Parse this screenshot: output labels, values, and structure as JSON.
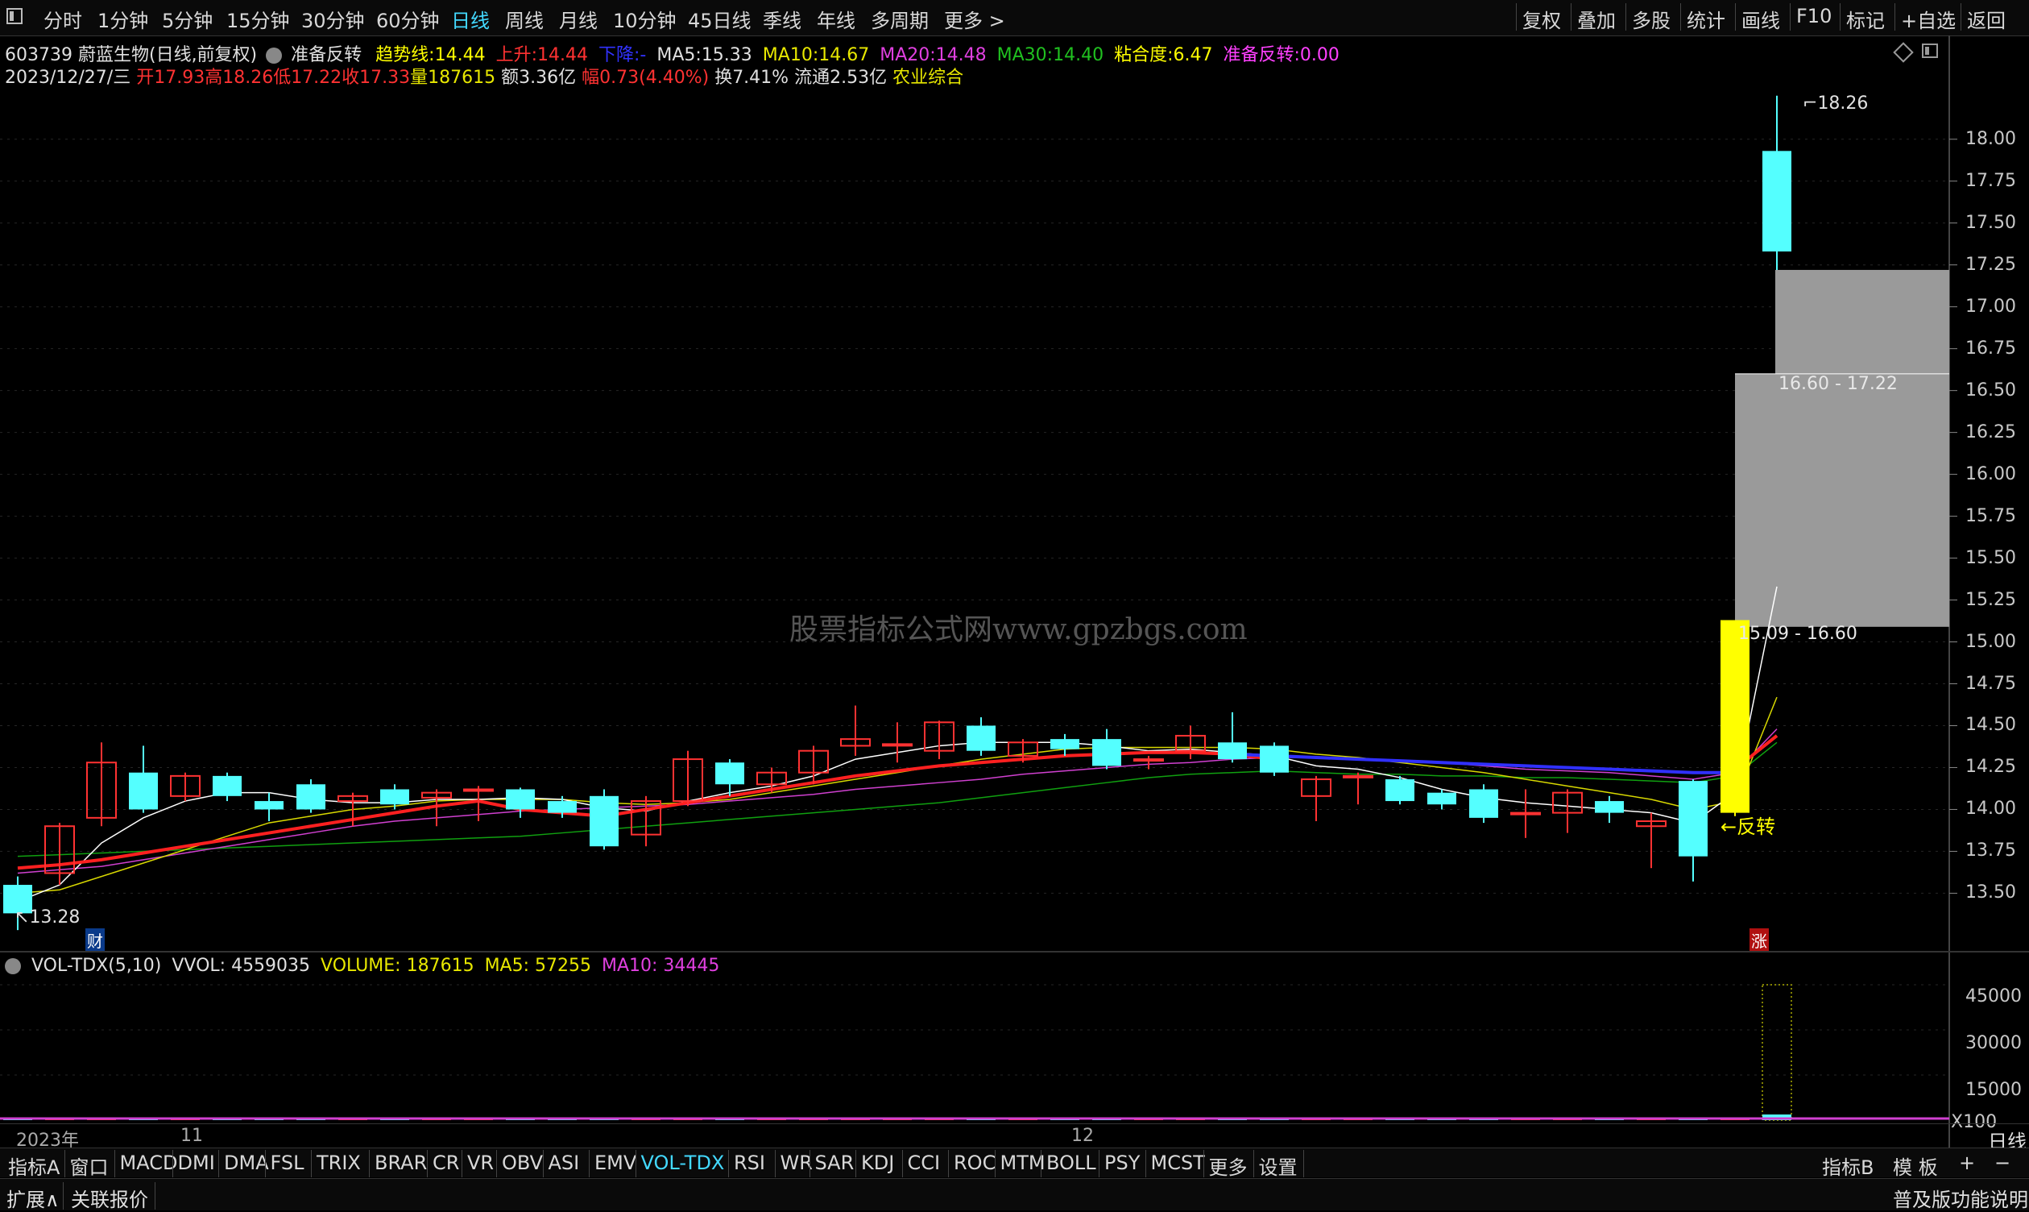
{
  "toolbar": {
    "periods": [
      "分时",
      "1分钟",
      "5分钟",
      "15分钟",
      "30分钟",
      "60分钟",
      "日线",
      "周线",
      "月线",
      "10分钟",
      "45日线",
      "季线",
      "年线",
      "多周期",
      "更多 >"
    ],
    "active_period": "日线",
    "right_buttons": [
      "复权",
      "叠加",
      "多股",
      "统计",
      "画线",
      "F10",
      "标记",
      "+自选",
      "返回"
    ]
  },
  "header": {
    "code": "603739",
    "name_mode": "蔚蓝生物(日线,前复权)",
    "indicator_name": "准备反转",
    "trend_label": "趋势线:",
    "trend_value": "14.44",
    "up_label": "上升:",
    "up_value": "14.44",
    "down_label": "下降:",
    "down_value": "-",
    "ma5_label": "MA5:",
    "ma5_value": "15.33",
    "ma10_label": "MA10:",
    "ma10_value": "14.67",
    "ma20_label": "MA20:",
    "ma20_value": "14.48",
    "ma30_label": "MA30:",
    "ma30_value": "14.40",
    "stick_label": "粘合度:",
    "stick_value": "6.47",
    "ready_label": "准备反转:",
    "ready_value": "0.00"
  },
  "quote": {
    "date": "2023/12/27/三",
    "open": "开17.93",
    "high": "高18.26",
    "low": "低17.22",
    "close": "收17.33",
    "volume": "量187615",
    "amount": "额3.36亿",
    "change": "幅0.73(4.40%)",
    "turnover": "换7.41%",
    "float": "流通2.53亿",
    "sector": "农业综合"
  },
  "price_axis": [
    "18.00",
    "17.75",
    "17.50",
    "17.25",
    "17.00",
    "16.75",
    "16.50",
    "16.25",
    "16.00",
    "15.75",
    "15.50",
    "15.25",
    "15.00",
    "14.75",
    "14.50",
    "14.25",
    "14.00",
    "13.75",
    "13.50"
  ],
  "annotations": {
    "high_mark": "18.26",
    "low_mark": "13.28",
    "zone_upper": "16.60 - 17.22",
    "zone_lower": "15.09 - 16.60",
    "reversal": "←反转",
    "fin_badge": "财",
    "zhang_badge": "涨",
    "watermark": "股票指标公式网www.gpzbgs.com"
  },
  "volume_header": {
    "name": "VOL-TDX(5,10)",
    "vvol": "VVOL: 4559035",
    "volume": "VOLUME: 187615",
    "ma5": "MA5: 57255",
    "ma10": "MA10: 34445"
  },
  "volume_axis": [
    "45000",
    "30000",
    "15000",
    "X100"
  ],
  "date_axis": [
    "2023年",
    "11",
    "12"
  ],
  "period_label": "日线",
  "indicator_tabs": [
    "指标A",
    "窗口",
    "MACD",
    "DMI",
    "DMA",
    "FSL",
    "TRIX",
    "BRAR",
    "CR",
    "VR",
    "OBV",
    "ASI",
    "EMV",
    "VOL-TDX",
    "RSI",
    "WR",
    "SAR",
    "KDJ",
    "CCI",
    "ROC",
    "MTM",
    "BOLL",
    "PSY",
    "MCST",
    "更多",
    "设置"
  ],
  "active_indicator": "VOL-TDX",
  "right_tabs": [
    "指标B",
    "模 板",
    "+",
    "−"
  ],
  "bottom": {
    "expand": "扩展∧",
    "related": "关联报价",
    "help": "普及版功能说明"
  },
  "colors": {
    "up": "#ff3232",
    "down": "#54ffff",
    "trend": "#ffff00",
    "ma5": "#ffffff",
    "ma10": "#ffff00",
    "ma20": "#ff00ff",
    "ma30": "#00a000"
  },
  "chart_data": {
    "type": "candlestick",
    "ylim": [
      13.3,
      18.35
    ],
    "candles": [
      {
        "o": 13.55,
        "c": 13.38,
        "h": 13.6,
        "l": 13.28
      },
      {
        "o": 13.62,
        "c": 13.9,
        "h": 13.92,
        "l": 13.55
      },
      {
        "o": 13.95,
        "c": 14.28,
        "h": 14.4,
        "l": 13.9
      },
      {
        "o": 14.22,
        "c": 14.0,
        "h": 14.38,
        "l": 13.98
      },
      {
        "o": 14.08,
        "c": 14.2,
        "h": 14.22,
        "l": 14.05
      },
      {
        "o": 14.2,
        "c": 14.08,
        "h": 14.22,
        "l": 14.05
      },
      {
        "o": 14.05,
        "c": 14.0,
        "h": 14.1,
        "l": 13.93
      },
      {
        "o": 14.15,
        "c": 14.0,
        "h": 14.18,
        "l": 13.98
      },
      {
        "o": 14.05,
        "c": 14.08,
        "h": 14.1,
        "l": 13.9
      },
      {
        "o": 14.12,
        "c": 14.03,
        "h": 14.15,
        "l": 14.0
      },
      {
        "o": 14.07,
        "c": 14.1,
        "h": 14.12,
        "l": 13.9
      },
      {
        "o": 14.12,
        "c": 14.12,
        "h": 14.14,
        "l": 13.93
      },
      {
        "o": 14.12,
        "c": 14.0,
        "h": 14.13,
        "l": 13.95
      },
      {
        "o": 14.05,
        "c": 13.98,
        "h": 14.08,
        "l": 13.95
      },
      {
        "o": 14.08,
        "c": 13.78,
        "h": 14.12,
        "l": 13.76
      },
      {
        "o": 13.85,
        "c": 14.05,
        "h": 14.08,
        "l": 13.78
      },
      {
        "o": 14.05,
        "c": 14.3,
        "h": 14.35,
        "l": 14.02
      },
      {
        "o": 14.28,
        "c": 14.15,
        "h": 14.3,
        "l": 14.08
      },
      {
        "o": 14.15,
        "c": 14.22,
        "h": 14.25,
        "l": 14.1
      },
      {
        "o": 14.22,
        "c": 14.35,
        "h": 14.38,
        "l": 14.15
      },
      {
        "o": 14.38,
        "c": 14.42,
        "h": 14.62,
        "l": 14.32
      },
      {
        "o": 14.39,
        "c": 14.39,
        "h": 14.52,
        "l": 14.28
      },
      {
        "o": 14.35,
        "c": 14.52,
        "h": 14.53,
        "l": 14.3
      },
      {
        "o": 14.5,
        "c": 14.35,
        "h": 14.55,
        "l": 14.32
      },
      {
        "o": 14.32,
        "c": 14.4,
        "h": 14.42,
        "l": 14.28
      },
      {
        "o": 14.42,
        "c": 14.36,
        "h": 14.45,
        "l": 14.32
      },
      {
        "o": 14.42,
        "c": 14.26,
        "h": 14.48,
        "l": 14.24
      },
      {
        "o": 14.3,
        "c": 14.3,
        "h": 14.32,
        "l": 14.24
      },
      {
        "o": 14.35,
        "c": 14.44,
        "h": 14.5,
        "l": 14.3
      },
      {
        "o": 14.4,
        "c": 14.3,
        "h": 14.58,
        "l": 14.28
      },
      {
        "o": 14.38,
        "c": 14.22,
        "h": 14.4,
        "l": 14.2
      },
      {
        "o": 14.08,
        "c": 14.18,
        "h": 14.2,
        "l": 13.93
      },
      {
        "o": 14.2,
        "c": 14.2,
        "h": 14.22,
        "l": 14.03
      },
      {
        "o": 14.18,
        "c": 14.05,
        "h": 14.2,
        "l": 14.03
      },
      {
        "o": 14.1,
        "c": 14.03,
        "h": 14.12,
        "l": 14.0
      },
      {
        "o": 14.12,
        "c": 13.95,
        "h": 14.15,
        "l": 13.92
      },
      {
        "o": 13.98,
        "c": 13.98,
        "h": 14.12,
        "l": 13.83
      },
      {
        "o": 13.98,
        "c": 14.1,
        "h": 14.12,
        "l": 13.86
      },
      {
        "o": 14.05,
        "c": 13.98,
        "h": 14.08,
        "l": 13.92
      },
      {
        "o": 13.9,
        "c": 13.93,
        "h": 13.98,
        "l": 13.65
      },
      {
        "o": 14.17,
        "c": 13.72,
        "h": 14.18,
        "l": 13.57
      },
      {
        "o": 13.98,
        "c": 15.13,
        "h": 15.13,
        "l": 13.96
      },
      {
        "o": 17.93,
        "c": 17.33,
        "h": 18.26,
        "l": 17.22
      }
    ],
    "ma5": [
      13.45,
      13.55,
      13.8,
      13.95,
      14.05,
      14.1,
      14.1,
      14.06,
      14.04,
      14.04,
      14.06,
      14.06,
      14.07,
      14.06,
      14.01,
      13.99,
      14.05,
      14.1,
      14.14,
      14.2,
      14.3,
      14.34,
      14.38,
      14.4,
      14.4,
      14.4,
      14.38,
      14.35,
      14.36,
      14.34,
      14.32,
      14.26,
      14.24,
      14.19,
      14.12,
      14.07,
      14.04,
      14.02,
      14.0,
      13.98,
      13.92,
      14.1,
      15.33
    ],
    "ma10": [
      13.5,
      13.52,
      13.6,
      13.68,
      13.76,
      13.84,
      13.92,
      13.96,
      14.0,
      14.02,
      14.05,
      14.06,
      14.06,
      14.06,
      14.04,
      14.03,
      14.04,
      14.06,
      14.1,
      14.14,
      14.18,
      14.22,
      14.26,
      14.3,
      14.33,
      14.36,
      14.37,
      14.37,
      14.37,
      14.37,
      14.36,
      14.33,
      14.31,
      14.28,
      14.25,
      14.22,
      14.18,
      14.14,
      14.1,
      14.06,
      14.0,
      14.05,
      14.67
    ],
    "ma20": [
      13.62,
      13.64,
      13.66,
      13.7,
      13.74,
      13.78,
      13.82,
      13.86,
      13.9,
      13.93,
      13.95,
      13.97,
      13.99,
      14.0,
      14.01,
      14.02,
      14.03,
      14.05,
      14.07,
      14.09,
      14.12,
      14.14,
      14.16,
      14.18,
      14.21,
      14.23,
      14.25,
      14.27,
      14.28,
      14.3,
      14.31,
      14.31,
      14.3,
      14.29,
      14.28,
      14.26,
      14.24,
      14.23,
      14.22,
      14.2,
      14.18,
      14.22,
      14.48
    ],
    "ma30": [
      13.72,
      13.73,
      13.74,
      13.75,
      13.76,
      13.77,
      13.78,
      13.79,
      13.8,
      13.81,
      13.82,
      13.83,
      13.84,
      13.86,
      13.88,
      13.9,
      13.92,
      13.94,
      13.96,
      13.98,
      14.0,
      14.02,
      14.04,
      14.07,
      14.1,
      14.13,
      14.16,
      14.19,
      14.21,
      14.22,
      14.23,
      14.22,
      14.21,
      14.21,
      14.2,
      14.2,
      14.19,
      14.19,
      14.18,
      14.17,
      14.16,
      14.2,
      14.4
    ],
    "trend_up": [
      13.65,
      13.67,
      13.7,
      13.74,
      13.78,
      13.82,
      13.86,
      13.9,
      13.94,
      13.98,
      14.02,
      14.05,
      14.0,
      13.98,
      13.96,
      14.0,
      14.04,
      14.08,
      14.12,
      14.16,
      14.2,
      14.23,
      14.26,
      14.28,
      14.3,
      14.32,
      14.33,
      14.34,
      14.34,
      14.33,
      14.3,
      null,
      null,
      null,
      null,
      null,
      null,
      null,
      null,
      null,
      null,
      14.24,
      14.44
    ],
    "trend_down": [
      null,
      null,
      null,
      null,
      null,
      null,
      null,
      null,
      null,
      null,
      null,
      null,
      null,
      null,
      null,
      null,
      null,
      null,
      null,
      null,
      null,
      null,
      null,
      null,
      null,
      null,
      null,
      null,
      null,
      14.33,
      14.32,
      14.31,
      14.3,
      14.29,
      14.28,
      14.27,
      14.26,
      14.25,
      14.24,
      14.23,
      14.22,
      14.22,
      null
    ],
    "volumes": [
      120,
      90,
      80,
      70,
      60,
      55,
      50,
      60,
      55,
      50,
      52,
      48,
      45,
      50,
      60,
      55,
      58,
      52,
      50,
      55,
      60,
      52,
      58,
      50,
      48,
      50,
      52,
      45,
      50,
      48,
      46,
      44,
      42,
      40,
      42,
      38,
      40,
      38,
      36,
      50,
      80,
      900,
      1876
    ],
    "volume_ylim": [
      0,
      45000
    ]
  }
}
